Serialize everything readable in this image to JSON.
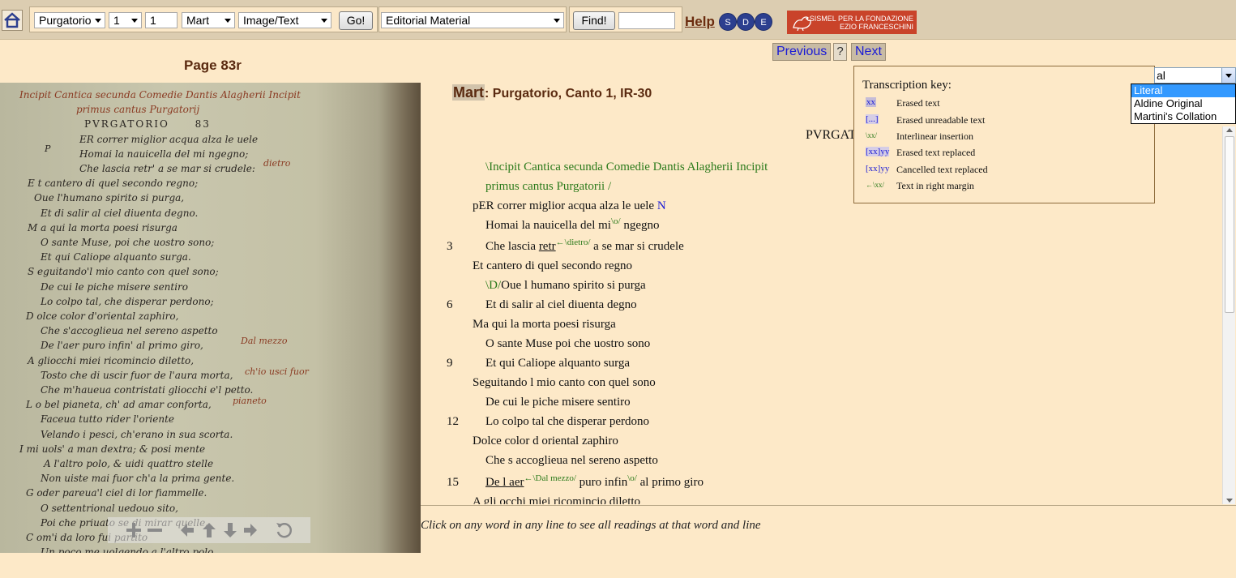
{
  "toolbar": {
    "part_select": "Purgatorio",
    "canto_select": "1",
    "line_input": "1",
    "witness_select": "Mart",
    "view_select": "Image/Text",
    "go_label": "Go!",
    "material_select": "Editorial Material",
    "find_label": "Find!",
    "find_input": "",
    "help_label": "Help",
    "sde_letters": [
      "S",
      "D",
      "E"
    ],
    "sismel_line1": "SISMEL PER LA FONDAZIONE",
    "sismel_line2": "EZIO FRANCESCHINI"
  },
  "page_title": "Page 83r",
  "nav": {
    "previous": "Previous",
    "help": "?",
    "next": "Next"
  },
  "heading": {
    "witness": "Mart",
    "rest": ": Purgatorio, Canto 1, IR-30"
  },
  "pvrgat": "PVRGAT",
  "transcript": {
    "line1": "\\Incipit Cantica secunda Comedie Dantis Alagherii Incipit",
    "line2": "primus cantus Purgatorii",
    "line2_slash": " /",
    "line3": "pER correr miglior acqua alza le uele",
    "line3_n": "N",
    "line4a": "Homai la nauicella del mi",
    "line4_sup": "\\o/",
    "line4b": " ngegno",
    "n3": "3",
    "line5a": "Che lascia ",
    "line5_u": "retr",
    "line5_sup": "←\\dietro/",
    "line5b": " a se mar si crudele",
    "line6": "Et cantero di quel secondo regno",
    "line7_green": "\\D/",
    "line7": "Oue l humano spirito si purga",
    "n6": "6",
    "line8": "Et di salir al ciel diuenta degno",
    "line9": "Ma qui la morta poesi risurga",
    "line10": "O sante Muse poi che uostro sono",
    "n9": "9",
    "line11": "Et qui Caliope alquanto surga",
    "line12": "Seguitando l mio canto con quel sono",
    "line13": "De cui le piche misere sentiro",
    "n12": "12",
    "line14": "Lo colpo tal che disperar perdono",
    "line15": "Dolce color d oriental zaphiro",
    "line16": "Che s accoglieua nel sereno aspetto",
    "n15": "15",
    "line17_u": "De l aer",
    "line17_sup1": "←\\Dal mezzo/",
    "line17a": " puro infin",
    "line17_sup2": "\\o/",
    "line17b": " al primo giro",
    "line18": "A gli occhi miei ricomincio diletto"
  },
  "hint": "Click on any word in any line to see all readings at that word and line",
  "key": {
    "title": "Transcription key:",
    "rows": [
      {
        "sample": "xx",
        "desc": "Erased text"
      },
      {
        "sample": "[...]",
        "desc": "Erased unreadable text"
      },
      {
        "sample": "\\xx/",
        "desc": "Interlinear insertion"
      },
      {
        "sample": "[xx]yy",
        "desc": "Erased text replaced"
      },
      {
        "sample": "[xx]yy",
        "desc": "Cancelled text replaced"
      },
      {
        "sample": "←\\xx/",
        "desc": "Text in right margin"
      }
    ]
  },
  "view_dropdown": {
    "current": "al",
    "options": [
      "Literal",
      "Aldine Original",
      "Martini's Collation"
    ]
  },
  "manuscript": {
    "header1": "Incipit Cantica secunda Comedie Dantis Alagherii Incipit",
    "header2": "primus cantus Purgatorij",
    "running_head": "PVRGATORIO",
    "page_no": "83",
    "lines": [
      "ER correr miglior acqua alza le uele",
      "Homai la nauicella del mi ngegno;",
      "Che lascia retr' a se mar si crudele:",
      "E t cantero di quel secondo regno;",
      "Oue l'humano spirito si purga,",
      "Et di salir al ciel diuenta degno.",
      "M a qui la morta poesi risurga",
      "O sante Muse, poi che uostro sono;",
      "Et qui Caliope alquanto surga.",
      "S eguitando'l mio canto con quel sono;",
      "De cui le piche misere sentiro",
      "Lo colpo tal, che disperar perdono;",
      "D olce color d'oriental zaphiro,",
      "Che s'accoglieua nel sereno aspetto",
      "De l'aer puro infin' al primo giro,",
      "A gliocchi miei ricomincio diletto,",
      "Tosto che di uscir fuor de l'aura morta,",
      "Che m'haueua contristati gliocchi e'l petto.",
      "L o bel pianeta, ch' ad amar conforta,",
      "Faceua tutto rider l'oriente",
      "Velando i pesci, ch'erano in sua scorta.",
      "I mi uols' a man dextra; & posi mente",
      "A l'altro polo, & uidi quattro stelle",
      "Non uiste mai fuor ch'a la prima gente.",
      "G oder pareua'l ciel di lor fiammelle.",
      "O settentrional uedouo sito,",
      "Poi che priuato se di mirar quelle.",
      "C om'i da loro fui partito",
      "Un poco me uolgendo a l'altro polo"
    ],
    "marg_dietro": "dietro",
    "marg_p": "P",
    "marg_dalmezzo": "Dal mezzo",
    "marg_chio": "ch'io usci fuor",
    "marg_pianeto": "pianeto"
  }
}
